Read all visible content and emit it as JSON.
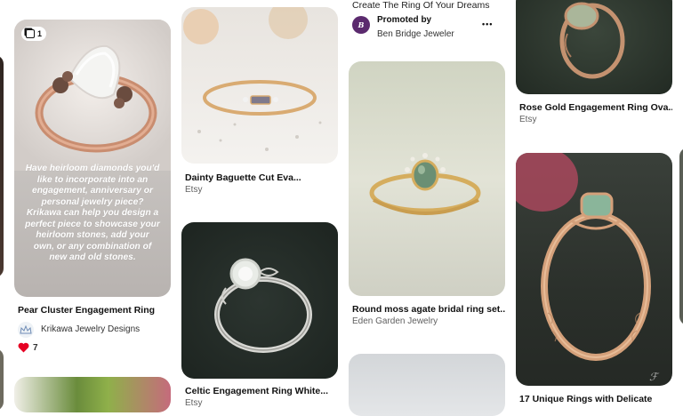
{
  "pins": {
    "pear": {
      "count_badge": "1",
      "overlay_text": "Have heirloom diamonds you'd like to incorporate into an engagement, anniversary or personal jewelry piece? Krikawa can help you design a perfect piece to showcase your heirloom stones, add your own, or any combination of new and old stones.",
      "title": "Pear Cluster Engagement Ring",
      "creator": "Krikawa Jewelry Designs",
      "reactions": "7"
    },
    "dainty": {
      "title": "Dainty Baguette Cut Eva...",
      "source": "Etsy"
    },
    "celtic": {
      "title": "Celtic Engagement Ring White...",
      "source": "Etsy"
    },
    "promoted": {
      "title": "Create The Ring Of Your Dreams",
      "promoted_label": "Promoted by",
      "advertiser": "Ben Bridge Jeweler",
      "avatar_letter": "B",
      "more": "•••"
    },
    "moss": {
      "title": "Round moss agate bridal ring set...",
      "source": "Eden Garden Jewelry"
    },
    "rosegold": {
      "title": "Rose Gold Engagement Ring Ova...",
      "source": "Etsy"
    },
    "unique": {
      "title": "17 Unique Rings with Delicate"
    }
  },
  "colors": {
    "accent_promoted": "#5b2a6e",
    "heart": "#e60023"
  },
  "icons": {
    "multi": "stacked-pages-icon",
    "heart": "heart-icon",
    "more": "more-dots-icon"
  }
}
